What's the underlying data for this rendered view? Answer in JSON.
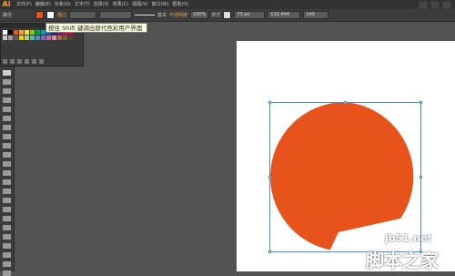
{
  "app": {
    "logo": "Ai"
  },
  "menu": [
    "文件(F)",
    "编辑(E)",
    "对象(O)",
    "文字(T)",
    "选择(S)",
    "效果(C)",
    "视图(V)",
    "窗口(W)",
    "帮助(H)"
  ],
  "control": {
    "mode": "路径",
    "fill_color": "#e8531b",
    "stroke_label": "描边",
    "stroke_profile": "基本",
    "opacity_label": "不透明度",
    "opacity_value": "100%",
    "style_label": "样式",
    "x_value": "73 px",
    "w_value": "132.444",
    "h_value": "145"
  },
  "tooltip": {
    "text": "按住 Shift 键调出替代色彩用户界面"
  },
  "swatches": [
    "#ffffff",
    "#000000",
    "#e8531b",
    "#f0a32a",
    "#f6e500",
    "#8dc21f",
    "#00a73c",
    "#00a0c6",
    "#0068b7",
    "#1d2088",
    "#920783",
    "#e4007f",
    "#e60033",
    "#c9c9c9",
    "#9e9e9e",
    "#5e5e5e",
    "#fdd000",
    "#b4d56a",
    "#5ab9a8",
    "#4a90c8",
    "#7e6bb5",
    "#c06ea8",
    "#e88a9e",
    "#a7694a",
    "#7d5a3c",
    "#593f2b"
  ],
  "shape": {
    "fill": "#e8531b"
  },
  "watermark": {
    "line1": "jb51.net",
    "line2": "脚本之家"
  },
  "colors": {
    "accent": "#e8531b",
    "selection": "#4a90c8"
  }
}
